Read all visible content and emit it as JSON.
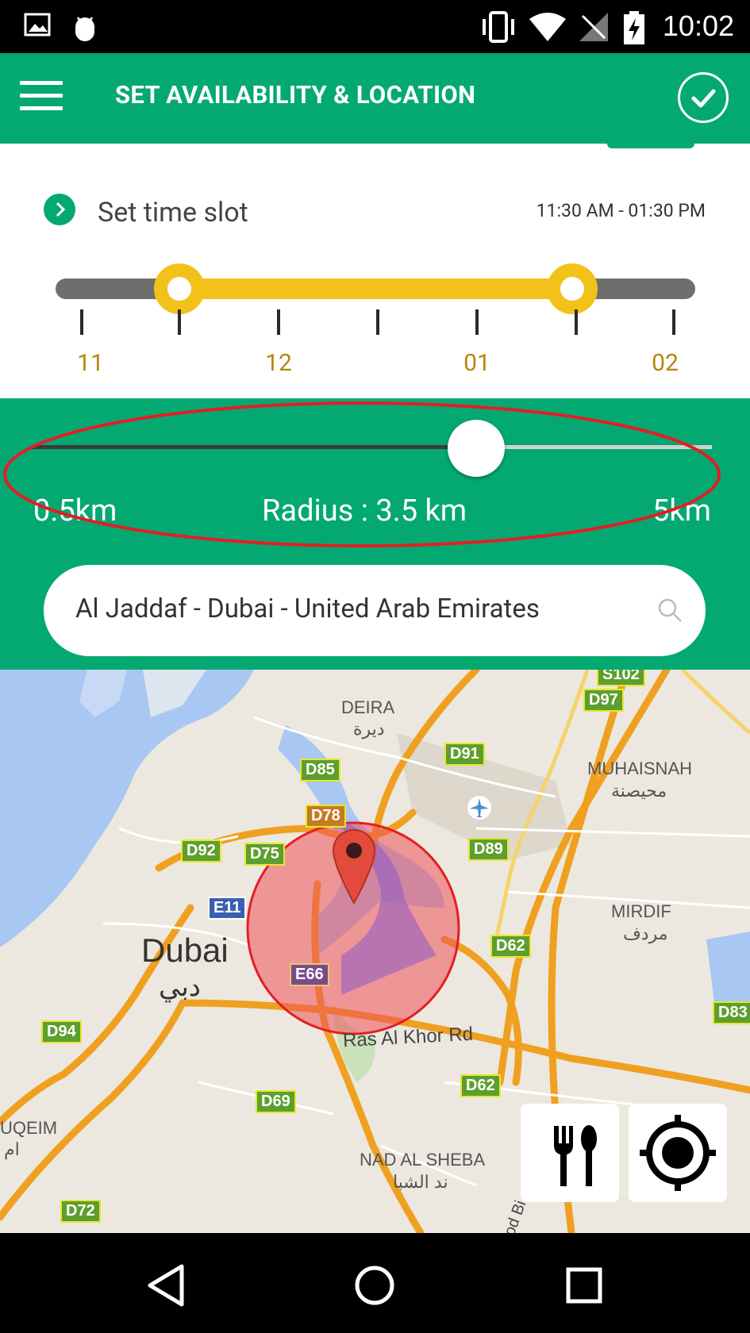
{
  "status_bar": {
    "time": "10:02"
  },
  "app_bar": {
    "title": "SET AVAILABILITY & LOCATION"
  },
  "time_slot": {
    "label": "Set time slot",
    "value": "11:30 AM - 01:30 PM",
    "hour_labels": [
      "11",
      "12",
      "01",
      "02"
    ],
    "start": "11:30 AM",
    "end": "01:30 PM"
  },
  "radius": {
    "min_label": "0.5km",
    "label": "Radius : 3.5 km",
    "max_label": "5km",
    "value_km": 3.5,
    "min_km": 0.5,
    "max_km": 5
  },
  "search": {
    "value": "Al Jaddaf - Dubai - United Arab Emirates"
  },
  "map": {
    "city_label": "Dubai",
    "city_label_ar": "دبي",
    "areas": [
      {
        "name": "DEIRA",
        "ar": "ديرة"
      },
      {
        "name": "MUHAISNAH",
        "ar": "محيصنة"
      },
      {
        "name": "MIRDIF",
        "ar": "مردف"
      },
      {
        "name": "NAD AL SHEBA",
        "ar": "ند الشبا"
      },
      {
        "name": "UQEIM",
        "ar": "ام"
      }
    ],
    "road_label": "Ras Al Khor Rd",
    "route_shields": [
      "S102",
      "D97",
      "D91",
      "D85",
      "D78",
      "D75",
      "D92",
      "D89",
      "E11",
      "D62",
      "E66",
      "D94",
      "D62",
      "D83",
      "D69",
      "D72"
    ],
    "partial_label": "od Bi"
  },
  "colors": {
    "primary": "#04a972",
    "accent": "#f2c21a",
    "highlight": "#e31e24"
  },
  "icons": [
    "menu-icon",
    "check-icon",
    "search-icon",
    "restaurant-icon",
    "my-location-icon",
    "back-icon",
    "home-icon",
    "recents-icon"
  ]
}
